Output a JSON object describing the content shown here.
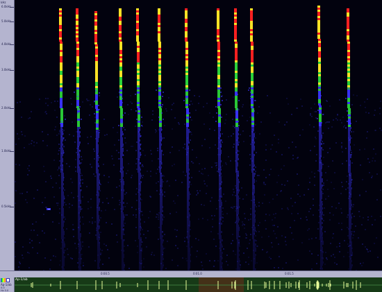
{
  "app": {
    "track_name": "Ap-1/ab",
    "track_info_1": "0.0",
    "track_info_2": "Hz 0.0"
  },
  "frequency_ruler": {
    "top_label": "kHz",
    "ticks": [
      {
        "label": "6.0kHz",
        "level": 0.975
      },
      {
        "label": "5.0kHz",
        "level": 0.92
      },
      {
        "label": "4.0kHz",
        "level": 0.835
      },
      {
        "label": "3.0kHz",
        "level": 0.74
      },
      {
        "label": "2.0kHz",
        "level": 0.6
      },
      {
        "label": "1.0kHz",
        "level": 0.44
      },
      {
        "label": "0.5kHz",
        "level": 0.235
      }
    ]
  },
  "time_ruler": {
    "labels": [
      "0:00.5",
      "0:01.0",
      "0:01.5"
    ]
  },
  "calls": [
    {
      "t": 0.125,
      "top": 0.97
    },
    {
      "t": 0.17,
      "top": 0.97
    },
    {
      "t": 0.222,
      "top": 0.96
    },
    {
      "t": 0.288,
      "top": 0.97
    },
    {
      "t": 0.335,
      "top": 0.97
    },
    {
      "t": 0.393,
      "top": 0.97
    },
    {
      "t": 0.466,
      "top": 0.97
    },
    {
      "t": 0.554,
      "top": 0.97
    },
    {
      "t": 0.601,
      "top": 0.97
    },
    {
      "t": 0.645,
      "top": 0.97
    },
    {
      "t": 0.828,
      "top": 0.98
    },
    {
      "t": 0.908,
      "top": 0.97
    }
  ],
  "colors": {
    "background": "#02020e",
    "low": "#3b35ff",
    "mid": "#2bd13a",
    "high": "#ffe225",
    "peak": "#ff2020",
    "ruler": "#b4b4cf",
    "waveform_bg": "#173a17",
    "waveform_line": "#e9ff9a"
  }
}
